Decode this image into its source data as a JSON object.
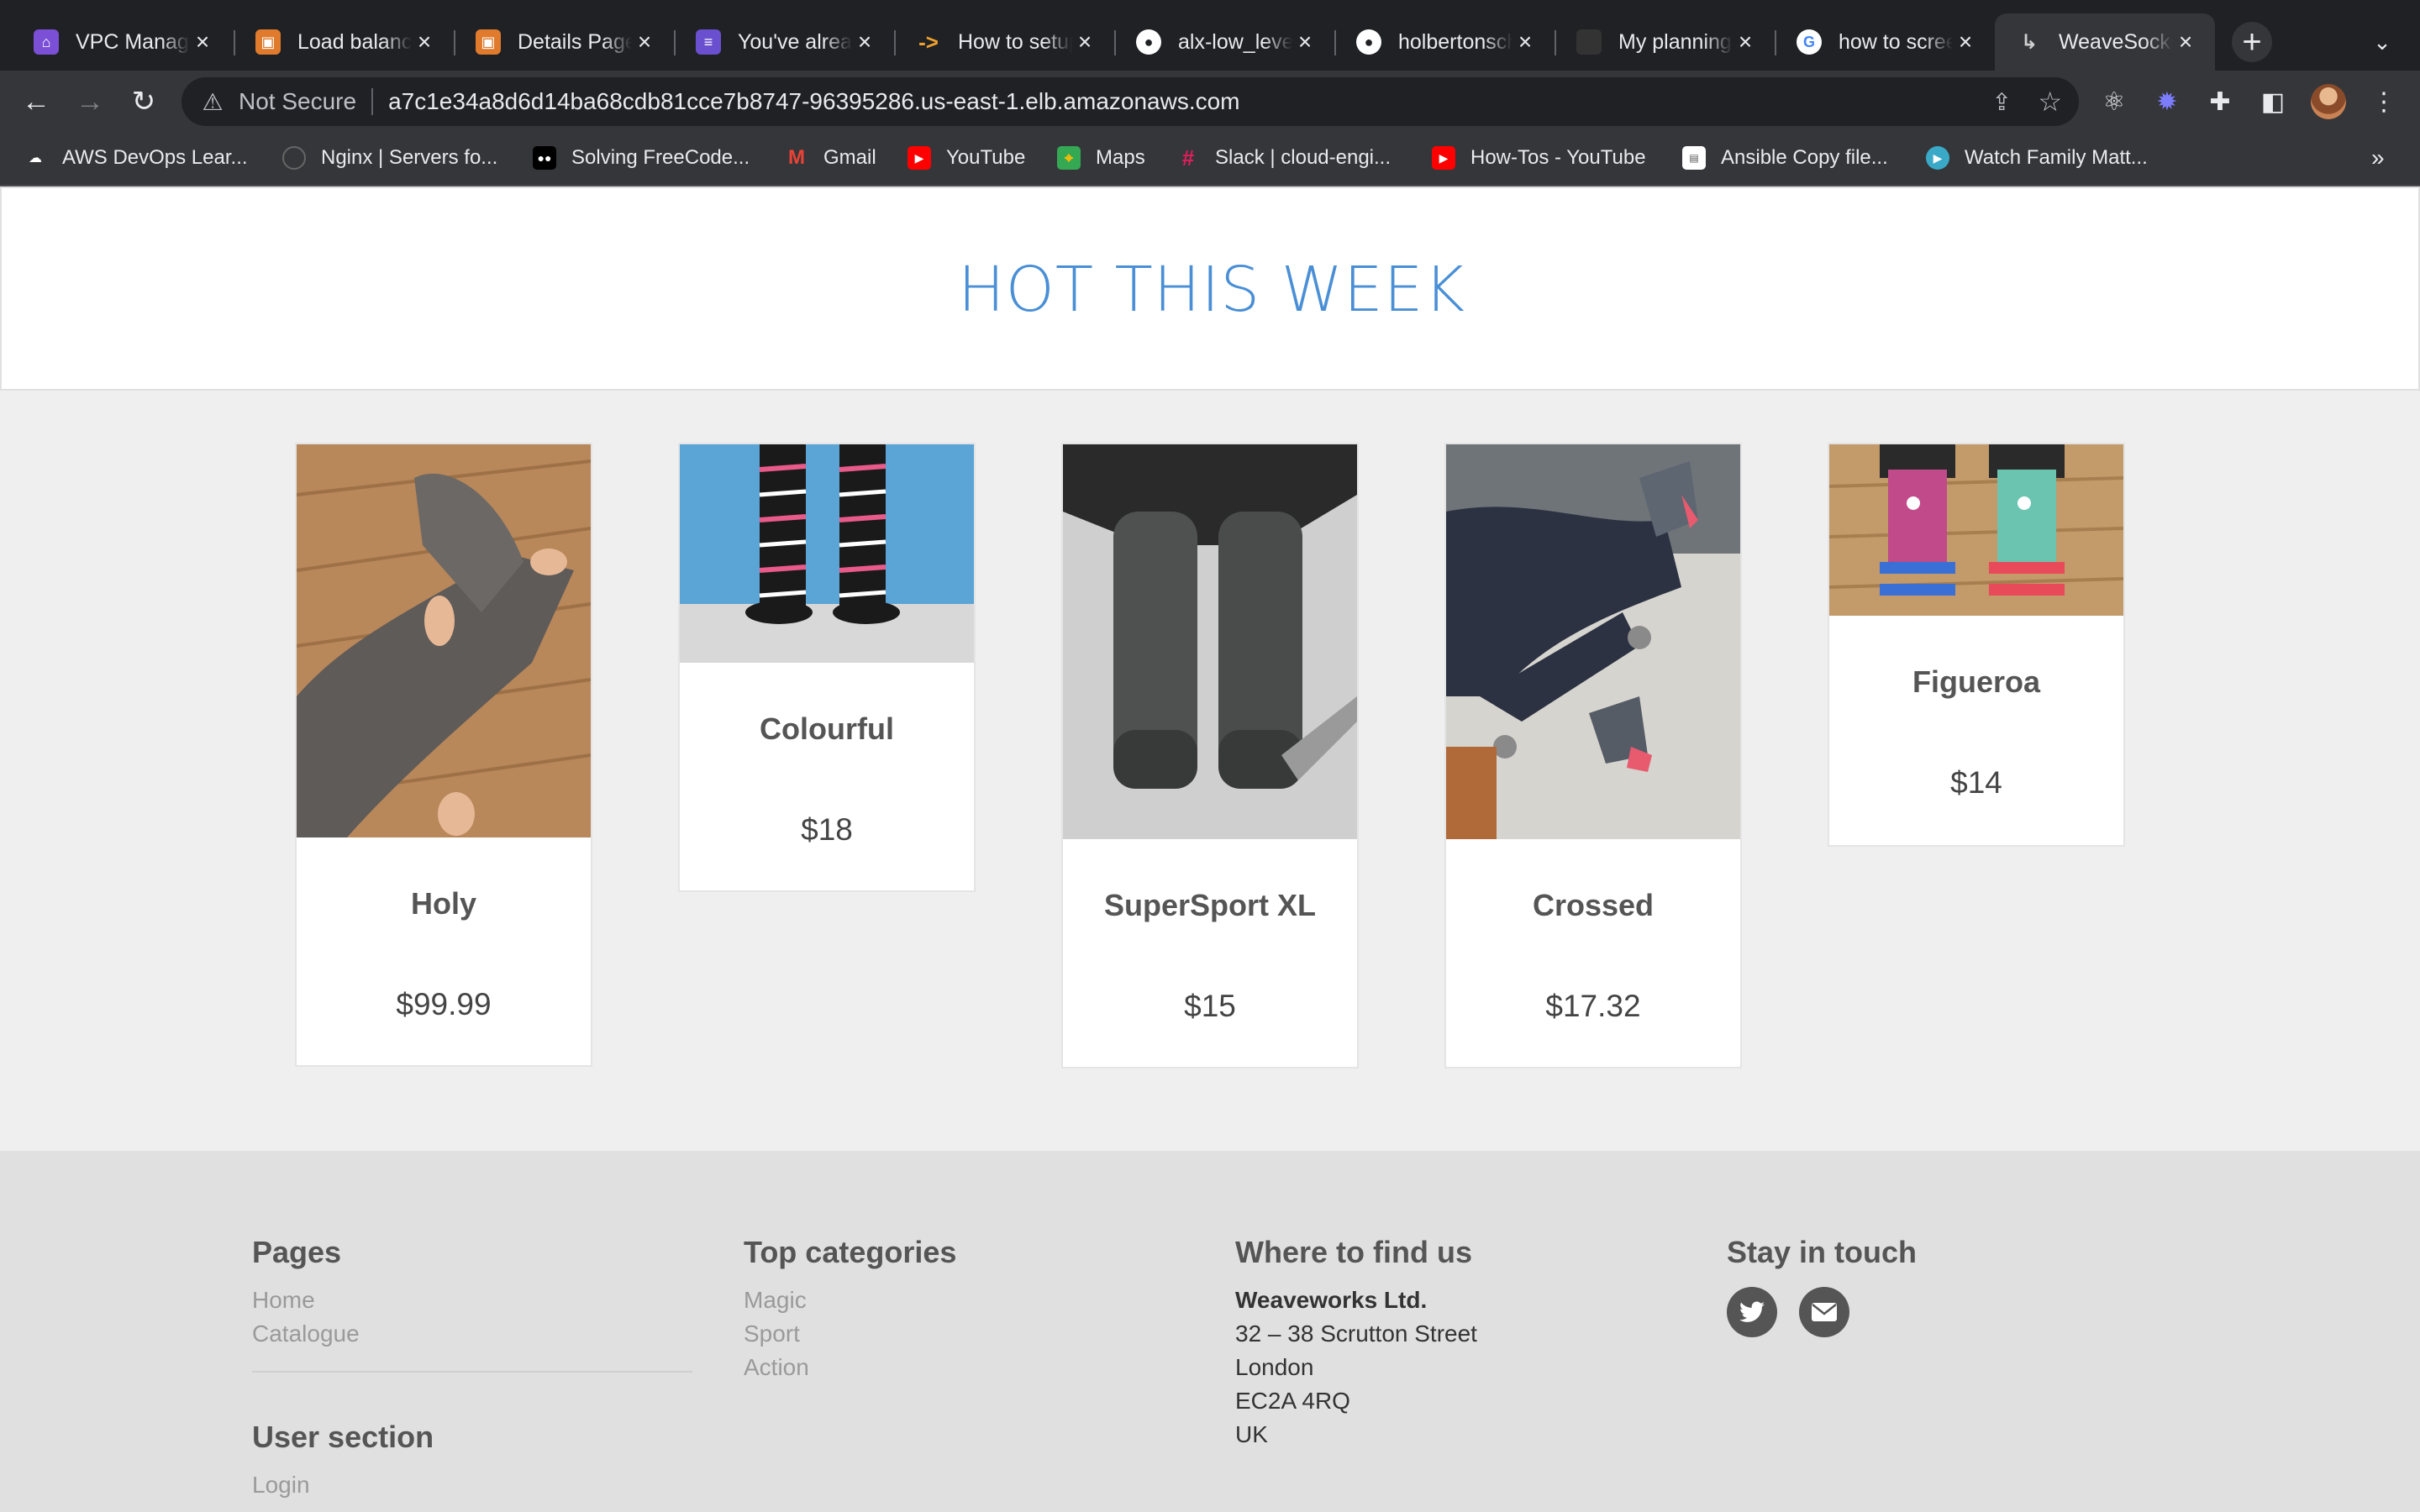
{
  "browser": {
    "tabs": [
      {
        "title": "VPC Management",
        "icon": "vpc-icon",
        "color": "#7b4fd6"
      },
      {
        "title": "Load balancers",
        "icon": "load-balancer-icon",
        "color": "#e07b2e"
      },
      {
        "title": "Details Page",
        "icon": "details-icon",
        "color": "#e07b2e"
      },
      {
        "title": "You've already",
        "icon": "list-icon",
        "color": "#6a4fcf"
      },
      {
        "title": "How to setup",
        "icon": "arrow-icon",
        "color": "#f0a030"
      },
      {
        "title": "alx-low_level",
        "icon": "github-icon",
        "color": "#ffffff"
      },
      {
        "title": "holbertonschool",
        "icon": "github-icon",
        "color": "#ffffff"
      },
      {
        "title": "My planning",
        "icon": "planning-icon",
        "color": "#333333"
      },
      {
        "title": "how to screenshot",
        "icon": "google-icon",
        "color": "#4285f4"
      },
      {
        "title": "WeaveSocks",
        "icon": "sock-icon",
        "color": "#cfcfcf"
      }
    ],
    "omnibox": {
      "security_label": "Not Secure",
      "url": "a7c1e34a8d6d14ba68cdb81cce7b8747-96395286.us-east-1.elb.amazonaws.com"
    },
    "bookmarks": [
      {
        "label": "AWS DevOps Lear...",
        "icon": "cloud-icon"
      },
      {
        "label": "Nginx | Servers fo...",
        "icon": "nginx-icon"
      },
      {
        "label": "Solving FreeCode...",
        "icon": "medium-icon"
      },
      {
        "label": "Gmail",
        "icon": "gmail-icon"
      },
      {
        "label": "YouTube",
        "icon": "youtube-icon"
      },
      {
        "label": "Maps",
        "icon": "maps-icon"
      },
      {
        "label": "Slack | cloud-engi...",
        "icon": "slack-icon"
      },
      {
        "label": "How-Tos - YouTube",
        "icon": "youtube-icon"
      },
      {
        "label": "Ansible Copy file...",
        "icon": "ansible-icon"
      },
      {
        "label": "Watch Family Matt...",
        "icon": "play-icon"
      }
    ],
    "bookmarks_more": "»"
  },
  "hot": {
    "title": "HOT THIS WEEK"
  },
  "products": [
    {
      "name": "Holy",
      "price": "$99.99"
    },
    {
      "name": "Colourful",
      "price": "$18"
    },
    {
      "name": "SuperSport XL",
      "price": "$15"
    },
    {
      "name": "Crossed",
      "price": "$17.32"
    },
    {
      "name": "Figueroa",
      "price": "$14"
    }
  ],
  "footer": {
    "pages": {
      "heading": "Pages",
      "links": [
        "Home",
        "Catalogue"
      ]
    },
    "user_section": {
      "heading": "User section",
      "links": [
        "Login"
      ]
    },
    "categories": {
      "heading": "Top categories",
      "links": [
        "Magic",
        "Sport",
        "Action"
      ]
    },
    "find_us": {
      "heading": "Where to find us",
      "company": "Weaveworks Ltd.",
      "address": [
        "32 – 38 Scrutton Street",
        "London",
        "EC2A 4RQ",
        "UK"
      ]
    },
    "touch": {
      "heading": "Stay in touch",
      "icons": [
        "twitter-icon",
        "envelope-icon"
      ]
    }
  }
}
